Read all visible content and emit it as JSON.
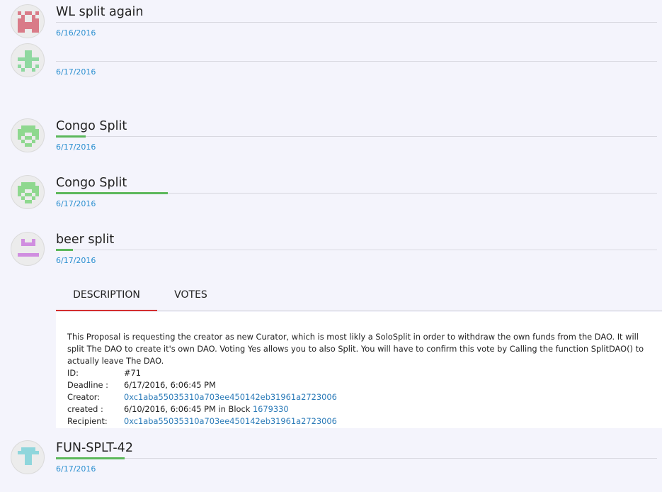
{
  "proposals": [
    {
      "title": "WL split again",
      "date": "6/16/2016",
      "progress": 0,
      "avatar_color": "#d97b88"
    },
    {
      "title": "",
      "date": "6/17/2016",
      "progress": 0,
      "avatar_color": "#8fd8a0"
    },
    {
      "title": "Congo Split",
      "date": "6/17/2016",
      "progress": 0.05,
      "avatar_color": "#8fd88f"
    },
    {
      "title": "Congo Split",
      "date": "6/17/2016",
      "progress": 0.186,
      "avatar_color": "#8fd88f"
    },
    {
      "title": "beer split",
      "date": "6/17/2016",
      "progress": 0.028,
      "avatar_color": "#d08ee0"
    },
    {
      "title": "FUN-SPLT-42",
      "date": "6/17/2016",
      "progress": 0.114,
      "avatar_color": "#8fd6dc"
    }
  ],
  "tabs": [
    {
      "label": "DESCRIPTION",
      "active": true
    },
    {
      "label": "VOTES",
      "active": false
    }
  ],
  "details": {
    "description": "This Proposal is requesting the creator as new Curator, which is most likly a SoloSplit in order to withdraw the own funds from the DAO. It will split The DAO to create it's own DAO. Voting Yes allows you to also Split. You will have to confirm this vote by Calling the function SplitDAO() to actually leave The DAO.",
    "id_label": "ID:",
    "id_value": "#71",
    "deadline_label": "Deadline :",
    "deadline_value": "6/17/2016, 6:06:45 PM",
    "creator_label": "Creator:",
    "creator_value": "0xc1aba55035310a703ee450142eb31961a2723006",
    "created_label": "created :",
    "created_value": "6/10/2016, 6:06:45 PM in Block",
    "created_block": "1679330",
    "recipient_label": "Recipient:",
    "recipient_value": "0xc1aba55035310a703ee450142eb31961a2723006"
  },
  "colors": {
    "progress": "#5cb85c",
    "date": "#2a8fd0",
    "link": "#2a7ab8",
    "tab_active": "#d32f2f",
    "background": "#f4f4fc"
  }
}
